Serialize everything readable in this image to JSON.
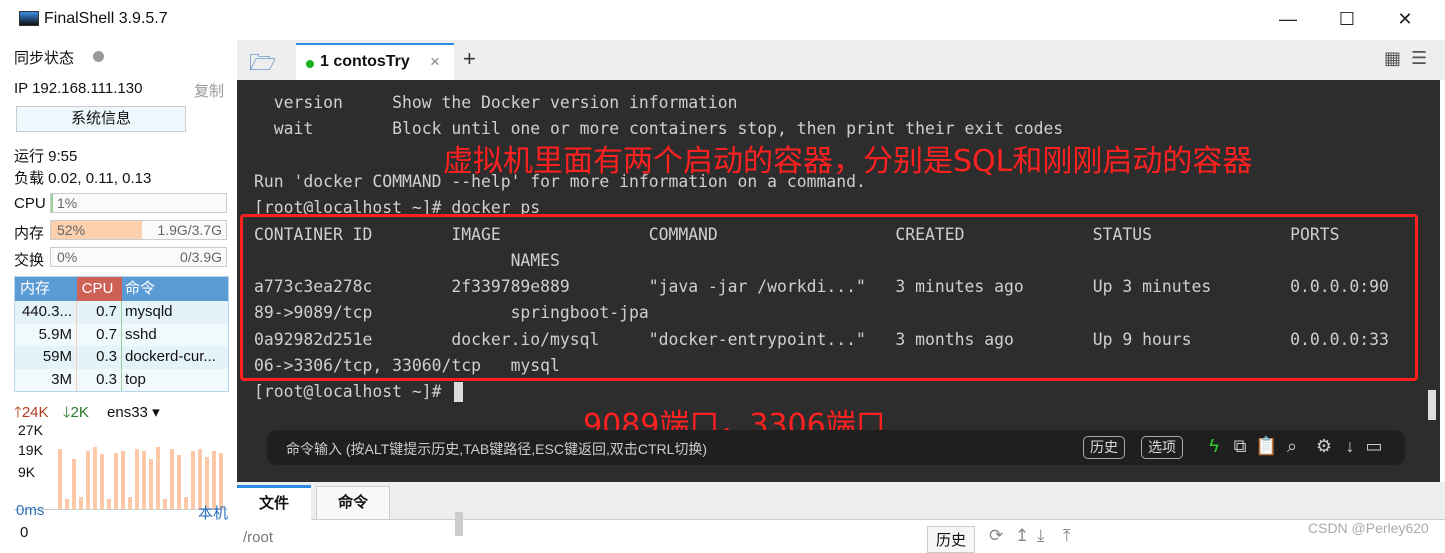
{
  "window": {
    "title": "FinalShell 3.9.5.7",
    "minimize": "—",
    "maximize": "☐",
    "close": "✕"
  },
  "sidebar": {
    "sync_label": "同步状态",
    "ip": "IP 192.168.111.130",
    "copy": "复制",
    "sysinfo_button": "系统信息",
    "uptime": "运行 9:55",
    "load": "负载 0.02, 0.11, 0.13",
    "cpu": {
      "label": "CPU",
      "value": "1%",
      "percent": 1
    },
    "mem": {
      "label": "内存",
      "value": "52%",
      "detail": "1.9G/3.7G",
      "percent": 52
    },
    "swap": {
      "label": "交换",
      "value": "0%",
      "detail": "0/3.9G",
      "percent": 0
    },
    "proc_headers": [
      "内存",
      "CPU",
      "命令"
    ],
    "processes": [
      [
        "440.3...",
        "0.7",
        "mysqld"
      ],
      [
        "5.9M",
        "0.7",
        "sshd"
      ],
      [
        "59M",
        "0.3",
        "dockerd-cur..."
      ],
      [
        "3M",
        "0.3",
        "top"
      ]
    ],
    "net": {
      "up": "24K",
      "down": "2K",
      "iface": "ens33",
      "ticks": [
        "27K",
        "19K",
        "9K"
      ]
    },
    "ping": {
      "latency": "0ms",
      "host": "本机",
      "value": "0"
    },
    "colors": {
      "mem_fill": "#fdd0ad",
      "table_header": "#5b9bd5",
      "cpu_header": "#cd6155"
    }
  },
  "tabs": [
    {
      "label": "1 contosTry",
      "close": "×"
    }
  ],
  "add_tab": "+",
  "terminal": {
    "lines": [
      "  version     Show the Docker version information",
      "  wait        Block until one or more containers stop, then print their exit codes",
      "",
      "Run 'docker COMMAND --help' for more information on a command.",
      "[root@localhost ~]# docker ps",
      "CONTAINER ID        IMAGE               COMMAND                  CREATED             STATUS              PORTS",
      "                          NAMES",
      "a773c3ea278c        2f339789e889        \"java -jar /workdi...\"   3 minutes ago       Up 3 minutes        0.0.0.0:90",
      "89->9089/tcp              springboot-jpa",
      "0a92982d251e        docker.io/mysql     \"docker-entrypoint...\"   3 months ago        Up 9 hours          0.0.0.0:33",
      "06->3306/tcp, 33060/tcp   mysql",
      "[root@localhost ~]# "
    ],
    "annotation_top": "虚拟机里面有两个启动的容器，分别是SQL和刚刚启动的容器",
    "annotation_bottom": "9089端口，3306端口"
  },
  "command_bar": {
    "placeholder": "命令输入 (按ALT键提示历史,TAB键路径,ESC键返回,双击CTRL切换)",
    "history": "历史",
    "options": "选项"
  },
  "bottom": {
    "tabs": [
      "文件",
      "命令"
    ],
    "path": "/root",
    "history": "历史"
  },
  "watermark": "CSDN @Perley620"
}
